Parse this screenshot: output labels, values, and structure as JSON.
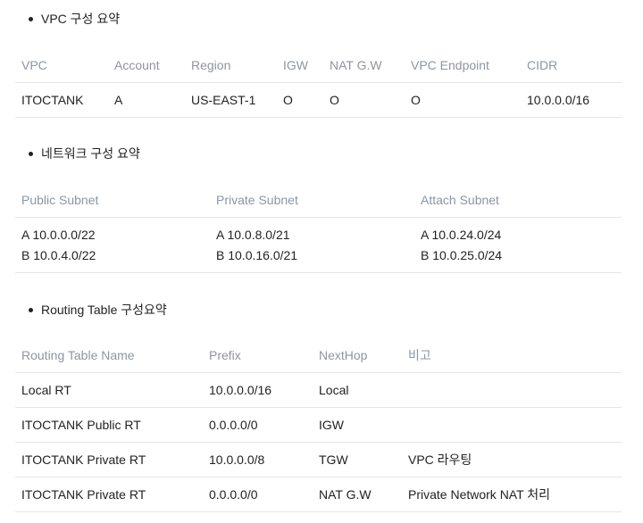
{
  "sections": [
    {
      "title": "VPC 구성 요약",
      "headers": [
        "VPC",
        "Account",
        "Region",
        "IGW",
        "NAT G.W",
        "VPC Endpoint",
        "CIDR"
      ],
      "rows": [
        [
          "ITOCTANK",
          "A",
          "US-EAST-1",
          "O",
          "O",
          "O",
          "10.0.0.0/16"
        ]
      ]
    },
    {
      "title": "네트워크 구성 요약",
      "headers": [
        "Public Subnet",
        "Private Subnet",
        "Attach Subnet"
      ],
      "rows": [
        [
          [
            "A 10.0.0.0/22",
            "B 10.0.4.0/22"
          ],
          [
            "A 10.0.8.0/21",
            "B 10.0.16.0/21"
          ],
          [
            "A 10.0.24.0/24",
            "B 10.0.25.0/24"
          ]
        ]
      ]
    },
    {
      "title": "Routing Table 구성요약",
      "headers": [
        "Routing Table Name",
        "Prefix",
        "NextHop",
        "비고"
      ],
      "rows": [
        [
          "Local RT",
          "10.0.0.0/16",
          "Local",
          ""
        ],
        [
          "ITOCTANK Public RT",
          "0.0.0.0/0",
          "IGW",
          ""
        ],
        [
          "ITOCTANK Private RT",
          "10.0.0.0/8",
          "TGW",
          "VPC 라우팅"
        ],
        [
          "ITOCTANK Private RT",
          "0.0.0.0/0",
          "NAT G.W",
          "Private Network NAT 처리"
        ]
      ]
    }
  ]
}
